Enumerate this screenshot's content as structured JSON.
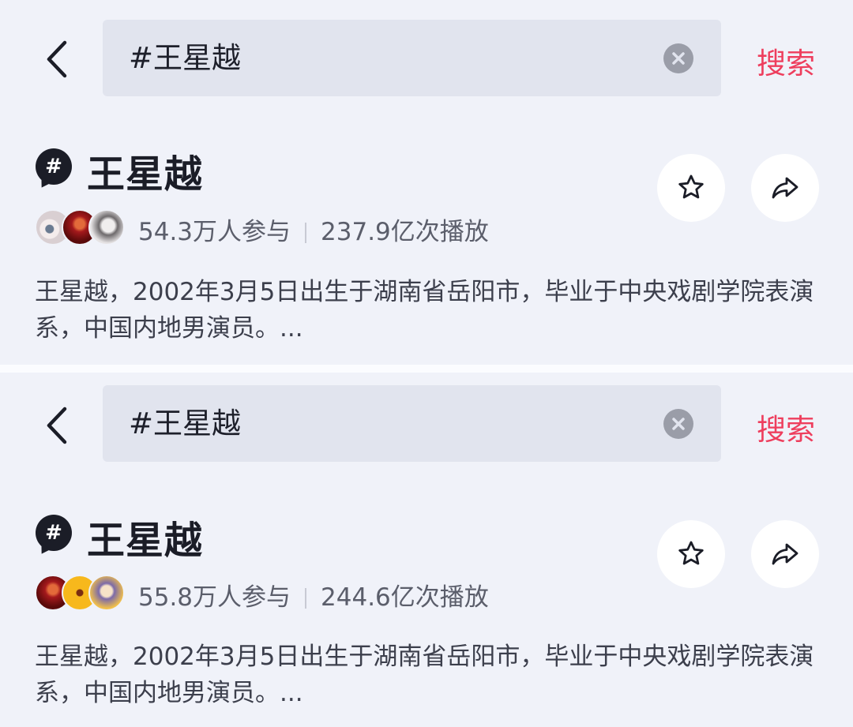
{
  "panels": [
    {
      "search": {
        "query": "#王星越",
        "button_label": "搜索"
      },
      "topic": {
        "title": "王星越",
        "participants": "54.3万人参与",
        "plays": "237.9亿次播放",
        "description": "王星越，2002年3月5日出生于湖南省岳阳市，毕业于中央戏剧学院表演系，中国内地男演员。..."
      },
      "avatars": [
        "anime-avatar",
        "red-poster-avatar",
        "portrait-avatar"
      ]
    },
    {
      "search": {
        "query": "#王星越",
        "button_label": "搜索"
      },
      "topic": {
        "title": "王星越",
        "participants": "55.8万人参与",
        "plays": "244.6亿次播放",
        "description": "王星越，2002年3月5日出生于湖南省岳阳市，毕业于中央戏剧学院表演系，中国内地男演员。..."
      },
      "avatars": [
        "red-poster-avatar",
        "yellow-badge-avatar",
        "costume-portrait-avatar"
      ]
    }
  ],
  "colors": {
    "accent": "#ee3e5d",
    "background": "#f0f2f9",
    "search_bg": "#e1e4ee"
  },
  "icons": [
    "back-arrow-icon",
    "clear-icon",
    "hashtag-icon",
    "star-icon",
    "share-icon"
  ]
}
